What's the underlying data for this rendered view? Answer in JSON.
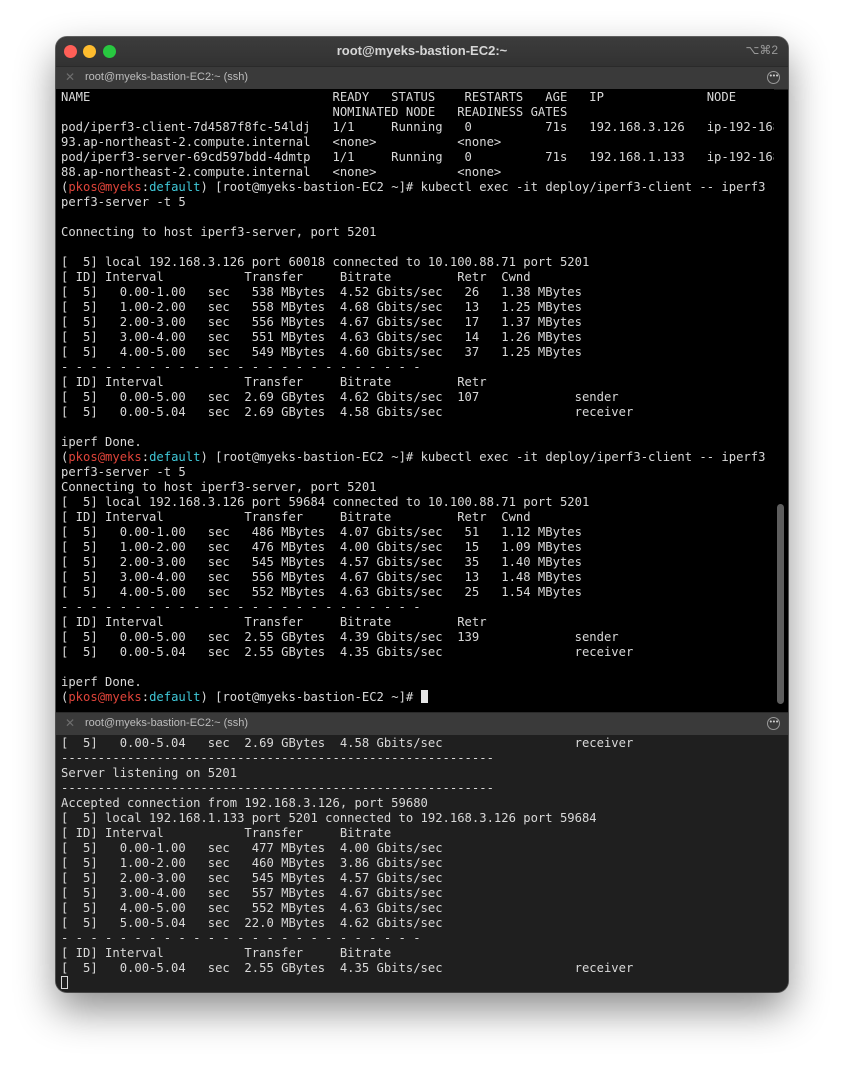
{
  "window": {
    "title": "root@myeks-bastion-EC2:~",
    "shortcut": "⌥⌘2"
  },
  "panes": [
    {
      "tab_label": "root@myeks-bastion-EC2:~ (ssh)",
      "lines": [
        "NAME                                 READY   STATUS    RESTARTS   AGE   IP              NODE",
        "                                     NOMINATED NODE   READINESS GATES",
        "pod/iperf3-client-7d4587f8fc-54ldj   1/1     Running   0          71s   192.168.3.126   ip-192-168-3-",
        "93.ap-northeast-2.compute.internal   <none>           <none>",
        "pod/iperf3-server-69cd597bdd-4dmtp   1/1     Running   0          71s   192.168.1.133   ip-192-168-1-",
        "88.ap-northeast-2.compute.internal   <none>           <none>",
        {
          "prompt": {
            "user": "pkos",
            "at": "@",
            "host": "myeks",
            "ctx": "default",
            "rest": "[root@myeks-bastion-EC2 ~]# "
          },
          "text": "kubectl exec -it deploy/iperf3-client -- iperf3 -c i"
        },
        "perf3-server -t 5",
        "",
        "Connecting to host iperf3-server, port 5201",
        "",
        "[  5] local 192.168.3.126 port 60018 connected to 10.100.88.71 port 5201",
        "[ ID] Interval           Transfer     Bitrate         Retr  Cwnd",
        "[  5]   0.00-1.00   sec   538 MBytes  4.52 Gbits/sec   26   1.38 MBytes",
        "[  5]   1.00-2.00   sec   558 MBytes  4.68 Gbits/sec   13   1.25 MBytes",
        "[  5]   2.00-3.00   sec   556 MBytes  4.67 Gbits/sec   17   1.37 MBytes",
        "[  5]   3.00-4.00   sec   551 MBytes  4.63 Gbits/sec   14   1.26 MBytes",
        "[  5]   4.00-5.00   sec   549 MBytes  4.60 Gbits/sec   37   1.25 MBytes",
        "- - - - - - - - - - - - - - - - - - - - - - - - -",
        "[ ID] Interval           Transfer     Bitrate         Retr",
        "[  5]   0.00-5.00   sec  2.69 GBytes  4.62 Gbits/sec  107             sender",
        "[  5]   0.00-5.04   sec  2.69 GBytes  4.58 Gbits/sec                  receiver",
        "",
        "iperf Done.",
        {
          "prompt": {
            "user": "pkos",
            "at": "@",
            "host": "myeks",
            "ctx": "default",
            "rest": "[root@myeks-bastion-EC2 ~]# "
          },
          "text": "kubectl exec -it deploy/iperf3-client -- iperf3 -c i"
        },
        "perf3-server -t 5",
        "Connecting to host iperf3-server, port 5201",
        "[  5] local 192.168.3.126 port 59684 connected to 10.100.88.71 port 5201",
        "[ ID] Interval           Transfer     Bitrate         Retr  Cwnd",
        "[  5]   0.00-1.00   sec   486 MBytes  4.07 Gbits/sec   51   1.12 MBytes",
        "[  5]   1.00-2.00   sec   476 MBytes  4.00 Gbits/sec   15   1.09 MBytes",
        "[  5]   2.00-3.00   sec   545 MBytes  4.57 Gbits/sec   35   1.40 MBytes",
        "[  5]   3.00-4.00   sec   556 MBytes  4.67 Gbits/sec   13   1.48 MBytes",
        "[  5]   4.00-5.00   sec   552 MBytes  4.63 Gbits/sec   25   1.54 MBytes",
        "- - - - - - - - - - - - - - - - - - - - - - - - -",
        "[ ID] Interval           Transfer     Bitrate         Retr",
        "[  5]   0.00-5.00   sec  2.55 GBytes  4.39 Gbits/sec  139             sender",
        "[  5]   0.00-5.04   sec  2.55 GBytes  4.35 Gbits/sec                  receiver",
        "",
        "iperf Done.",
        {
          "prompt": {
            "user": "pkos",
            "at": "@",
            "host": "myeks",
            "ctx": "default",
            "rest": "[root@myeks-bastion-EC2 ~]# "
          },
          "text": "",
          "cursor": "solid"
        }
      ]
    },
    {
      "tab_label": "root@myeks-bastion-EC2:~ (ssh)",
      "lines": [
        "[  5]   0.00-5.04   sec  2.69 GBytes  4.58 Gbits/sec                  receiver",
        "-----------------------------------------------------------",
        "Server listening on 5201",
        "-----------------------------------------------------------",
        "Accepted connection from 192.168.3.126, port 59680",
        "[  5] local 192.168.1.133 port 5201 connected to 192.168.3.126 port 59684",
        "[ ID] Interval           Transfer     Bitrate",
        "[  5]   0.00-1.00   sec   477 MBytes  4.00 Gbits/sec",
        "[  5]   1.00-2.00   sec   460 MBytes  3.86 Gbits/sec",
        "[  5]   2.00-3.00   sec   545 MBytes  4.57 Gbits/sec",
        "[  5]   3.00-4.00   sec   557 MBytes  4.67 Gbits/sec",
        "[  5]   4.00-5.00   sec   552 MBytes  4.63 Gbits/sec",
        "[  5]   5.00-5.04   sec  22.0 MBytes  4.62 Gbits/sec",
        "- - - - - - - - - - - - - - - - - - - - - - - - -",
        "[ ID] Interval           Transfer     Bitrate",
        "[  5]   0.00-5.04   sec  2.55 GBytes  4.35 Gbits/sec                  receiver",
        {
          "text": "",
          "cursor": "hollow"
        }
      ]
    }
  ]
}
